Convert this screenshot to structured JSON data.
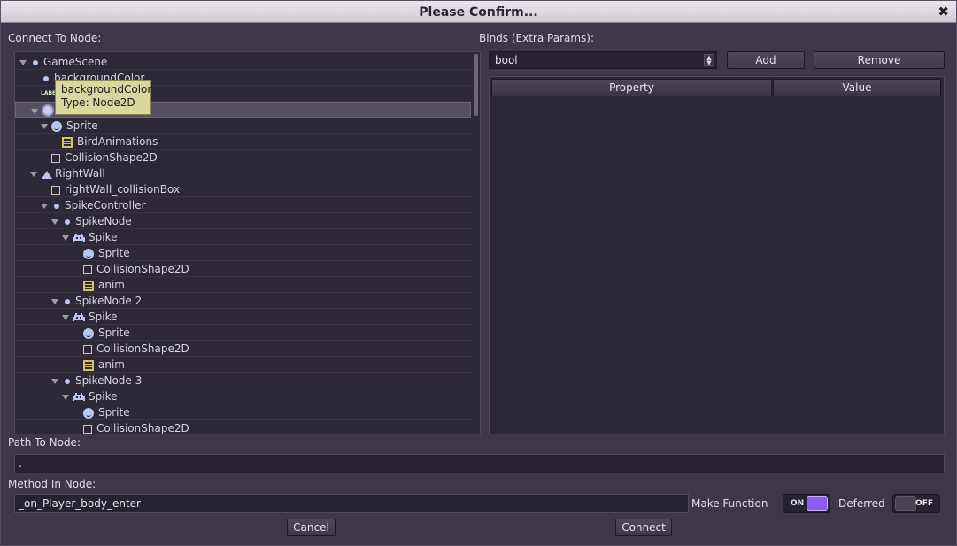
{
  "window": {
    "title": "Please Confirm..."
  },
  "left": {
    "label": "Connect To Node:"
  },
  "tree": [
    {
      "label": "GameScene",
      "indent": 0,
      "icon": "dot-icon",
      "arrow": true
    },
    {
      "label": "backgroundColor",
      "indent": 1,
      "icon": "dot-icon",
      "arrow": false
    },
    {
      "label": "",
      "indent": 1,
      "icon": "label-icon",
      "arrow": false
    },
    {
      "label": "",
      "indent": 1,
      "icon": "player-icon",
      "arrow": true,
      "selected": true
    },
    {
      "label": "Sprite",
      "indent": 2,
      "icon": "sprite-icon",
      "arrow": true
    },
    {
      "label": "BirdAnimations",
      "indent": 3,
      "icon": "film-icon",
      "arrow": false
    },
    {
      "label": "CollisionShape2D",
      "indent": 2,
      "icon": "box-icon",
      "arrow": false
    },
    {
      "label": "RightWall",
      "indent": 1,
      "icon": "wall-icon",
      "arrow": true
    },
    {
      "label": "rightWall_collisionBox",
      "indent": 2,
      "icon": "box-icon",
      "arrow": false
    },
    {
      "label": "SpikeController",
      "indent": 2,
      "icon": "dot-icon",
      "arrow": true
    },
    {
      "label": "SpikeNode",
      "indent": 3,
      "icon": "dot-icon",
      "arrow": true
    },
    {
      "label": "Spike",
      "indent": 4,
      "icon": "invader-icon",
      "arrow": true
    },
    {
      "label": "Sprite",
      "indent": 5,
      "icon": "sprite-icon",
      "arrow": false
    },
    {
      "label": "CollisionShape2D",
      "indent": 5,
      "icon": "box-icon",
      "arrow": false
    },
    {
      "label": "anim",
      "indent": 5,
      "icon": "film-icon",
      "arrow": false
    },
    {
      "label": "SpikeNode 2",
      "indent": 3,
      "icon": "dot-icon",
      "arrow": true
    },
    {
      "label": "Spike",
      "indent": 4,
      "icon": "invader-icon",
      "arrow": true
    },
    {
      "label": "Sprite",
      "indent": 5,
      "icon": "sprite-icon",
      "arrow": false
    },
    {
      "label": "CollisionShape2D",
      "indent": 5,
      "icon": "box-icon",
      "arrow": false
    },
    {
      "label": "anim",
      "indent": 5,
      "icon": "film-icon",
      "arrow": false
    },
    {
      "label": "SpikeNode 3",
      "indent": 3,
      "icon": "dot-icon",
      "arrow": true
    },
    {
      "label": "Spike",
      "indent": 4,
      "icon": "invader-icon",
      "arrow": true
    },
    {
      "label": "Sprite",
      "indent": 5,
      "icon": "sprite-icon",
      "arrow": false
    },
    {
      "label": "CollisionShape2D",
      "indent": 5,
      "icon": "box-icon",
      "arrow": false
    }
  ],
  "tooltip": {
    "line1": "backgroundColor",
    "line2": "Type: Node2D"
  },
  "binds": {
    "label": "Binds (Extra Params):",
    "type_value": "bool",
    "add_label": "Add",
    "remove_label": "Remove",
    "col_property": "Property",
    "col_value": "Value"
  },
  "path": {
    "label": "Path To Node:",
    "value": "."
  },
  "method": {
    "label": "Method In Node:",
    "value": "_on_Player_body_enter"
  },
  "make_function": {
    "label": "Make Function",
    "state": "ON"
  },
  "deferred": {
    "label": "Deferred",
    "state": "OFF"
  },
  "buttons": {
    "cancel": "Cancel",
    "connect": "Connect"
  },
  "colors": {
    "accent": "#8a5cf0",
    "panel": "#2c2836",
    "background": "#3d3748"
  }
}
